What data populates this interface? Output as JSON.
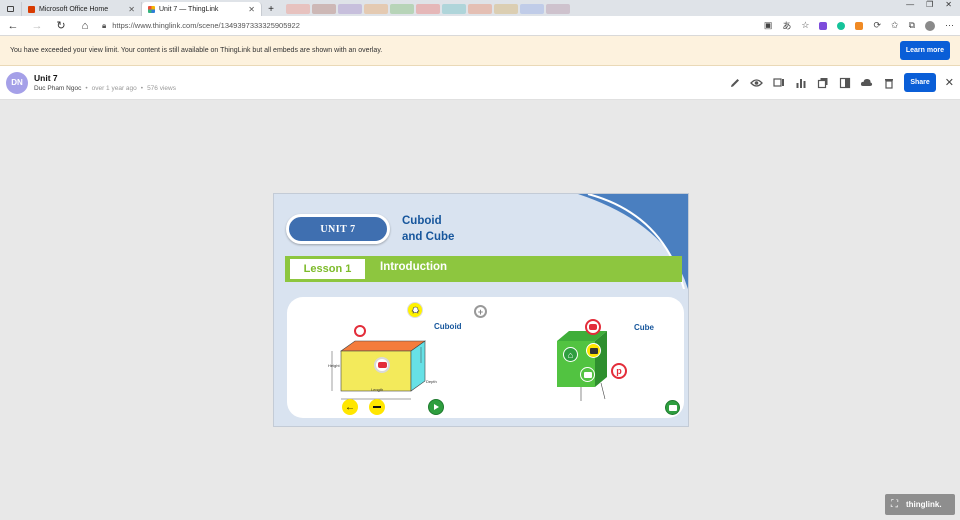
{
  "browser": {
    "tabs": [
      {
        "label": "Microsoft Office Home",
        "active": false
      },
      {
        "label": "Unit 7 — ThingLink",
        "active": true
      }
    ],
    "new_tab": "+",
    "url": "https://www.thinglink.com/scene/1349397333325905922"
  },
  "banner": {
    "text": "You have exceeded your view limit. Your content is still available on ThingLink but all embeds are shown with an overlay.",
    "button": "Learn more"
  },
  "header": {
    "avatar_initials": "DN",
    "title": "Unit 7",
    "author": "Duc Pham Ngoc",
    "separator": "•",
    "time_ago": "over 1 year ago",
    "views": "576 views",
    "share_label": "Share",
    "toolbar_icons": [
      "pencil-icon",
      "eye-icon",
      "presentation-icon",
      "stats-icon",
      "copy-icon",
      "tag-icon",
      "cloud-download-icon",
      "trash-icon"
    ]
  },
  "scene": {
    "unit_label": "UNIT 7",
    "topic_line1": "Cuboid",
    "topic_line2": "and Cube",
    "lesson_label": "Lesson 1",
    "lesson_title": "Introduction",
    "cuboid_label": "Cuboid",
    "cube_label": "Cube",
    "dim_length": "Length",
    "dim_height": "Height",
    "dim_depth": "Depth",
    "colors": {
      "accent_blue": "#3f6fb0",
      "green": "#8dc63f",
      "title_blue": "#17569c"
    }
  },
  "footer": {
    "brand": "thinglink."
  }
}
